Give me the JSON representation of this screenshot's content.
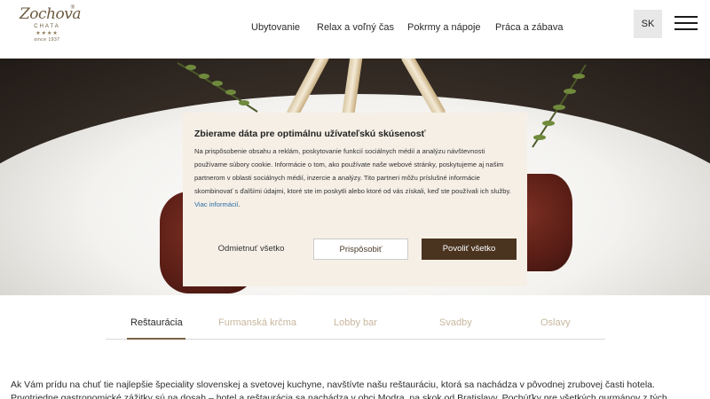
{
  "header": {
    "logo": {
      "wordmark": "Zochova",
      "subtitle": "CHATA",
      "stars": "★★★★",
      "since": "since 1937",
      "registered": "®"
    },
    "nav": [
      {
        "label": "Ubytovanie"
      },
      {
        "label": "Relax a voľný čas"
      },
      {
        "label": "Pokrmy a nápoje"
      },
      {
        "label": "Práca a zábava"
      }
    ],
    "language": "SK",
    "menu_icon": "hamburger-menu-icon"
  },
  "hero": {
    "image": "plated-dish-lamb-rack-with-herbs"
  },
  "consent": {
    "title": "Zbierame dáta pre optimálnu užívateľskú skúsenosť",
    "body": "Na prispôsobenie obsahu a reklám, poskytovanie funkcií sociálnych médií a analýzu návštevnosti používame súbory cookie. Informácie o tom, ako používate naše webové stránky, poskytujeme aj našim partnerom v oblasti sociálnych médií, inzercie a analýzy. Tito partneri môžu príslušné informácie skombinovať s ďalšími údajmi, ktoré ste im poskytli alebo ktoré od vás získali, keď ste používali ich služby.",
    "link": "Viac informácií",
    "link_suffix": ".",
    "buttons": {
      "reject": "Odmietnuť všetko",
      "customize": "Prispôsobiť",
      "allow": "Povoliť všetko"
    }
  },
  "tabs": [
    {
      "label": "Reštaurácia",
      "active": true
    },
    {
      "label": "Furmanská krčma",
      "active": false
    },
    {
      "label": "Lobby bar",
      "active": false
    },
    {
      "label": "Svadby",
      "active": false
    },
    {
      "label": "Oslavy",
      "active": false
    }
  ],
  "intro": "Ak Vám prídu na chuť tie najlepšie špeciality slovenskej a svetovej kuchyne, navštívte našu reštauráciu, ktorá sa nachádza v pôvodnej zrubovej časti hotela. Prvotriedne gastronomické zážitky sú na dosah – hotel a reštaurácia sa nachádza v obci Modra, na skok od Bratislavy. Pochúťky pre všetkých gurmánov z tých najlepších čerstvých",
  "colors": {
    "accent_brown": "#4a3420",
    "tab_inactive": "#c8b79e",
    "link_blue": "#2b6ea3",
    "dialog_bg": "#f5efe6"
  }
}
